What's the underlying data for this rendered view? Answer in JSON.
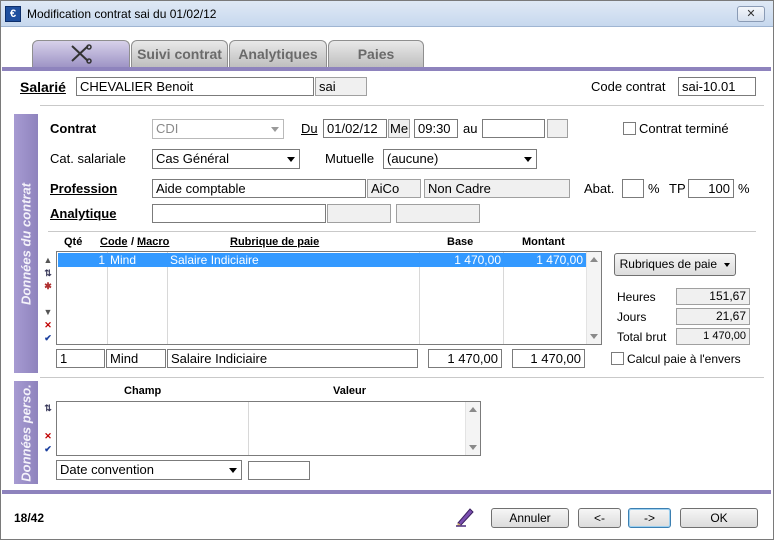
{
  "window": {
    "title": "Modification contrat sai du 01/02/12",
    "close_label": "✕"
  },
  "tabs": [
    {
      "label": "",
      "icon": "scissors-icon"
    },
    {
      "label": "Suivi contrat"
    },
    {
      "label": "Analytiques"
    },
    {
      "label": "Paies"
    }
  ],
  "header": {
    "salarie_label": "Salarié",
    "salarie_name": "CHEVALIER Benoit",
    "salarie_code": "sai",
    "code_contrat_label": "Code contrat",
    "code_contrat_value": "sai-10.01"
  },
  "contrat": {
    "section_label": "Données du contrat",
    "contrat_label": "Contrat",
    "contrat_value": "CDI",
    "du_label": "Du",
    "du_date": "01/02/12",
    "du_day": "Me",
    "du_time": "09:30",
    "au_label": "au",
    "au_date": "",
    "au_day": "",
    "termine_label": "Contrat terminé",
    "termine_checked": false,
    "cat_label": "Cat. salariale",
    "cat_value": "Cas Général",
    "mutuelle_label": "Mutuelle",
    "mutuelle_value": "(aucune)",
    "profession_label": "Profession",
    "profession_value": "Aide comptable",
    "profession_code": "AiCo",
    "profession_status": "Non Cadre",
    "abat_label": "Abat.",
    "abat_value": "",
    "abat_pct": "%",
    "tp_label": "TP",
    "tp_value": "100",
    "tp_pct": "%",
    "analytique_label": "Analytique",
    "analytique_value": "",
    "analytique_f2": "",
    "analytique_f3": ""
  },
  "rubriques": {
    "col_qte": "Qté",
    "col_code": "Code",
    "col_sep": "/",
    "col_macro": "Macro",
    "col_rubrique": "Rubrique de paie",
    "col_base": "Base",
    "col_montant": "Montant",
    "rows": [
      {
        "qte": "1",
        "code": "Mind",
        "rubrique": "Salaire Indiciaire",
        "base": "1 470,00",
        "montant": "1 470,00"
      }
    ],
    "edit": {
      "qte": "1",
      "code": "Mind",
      "rubrique": "Salaire Indiciaire",
      "base": "1 470,00",
      "montant": "1 470,00"
    },
    "button_label": "Rubriques de paie",
    "heures_label": "Heures",
    "heures_value": "151,67",
    "jours_label": "Jours",
    "jours_value": "21,67",
    "total_label": "Total brut",
    "total_value": "1 470,00",
    "calcul_label": "Calcul paie à l'envers",
    "calcul_checked": false
  },
  "perso": {
    "section_label": "Données perso.",
    "col_champ": "Champ",
    "col_valeur": "Valeur",
    "combo_value": "Date convention",
    "input_value": ""
  },
  "footer": {
    "counter": "18/42",
    "annuler": "Annuler",
    "prev": "<-",
    "next": "->",
    "ok": "OK"
  },
  "colors": {
    "accent": "#8e83bd",
    "selection": "#3399ff"
  }
}
